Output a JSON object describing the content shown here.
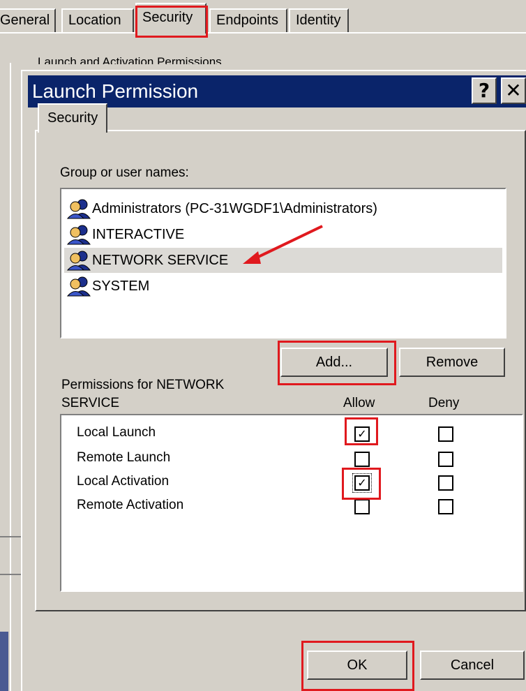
{
  "background_window": {
    "tabs": [
      "General",
      "Location",
      "Security",
      "Endpoints",
      "Identity"
    ],
    "active_tab": "Security",
    "group_caption": "Launch and Activation Permissions"
  },
  "dialog": {
    "title": "Launch Permission",
    "help_button": "?",
    "close_button": "✕",
    "tab": "Security",
    "group_label": "Group or user names:",
    "users": [
      "Administrators (PC-31WGDF1\\Administrators)",
      "INTERACTIVE",
      "NETWORK SERVICE",
      "SYSTEM"
    ],
    "selected_user": "NETWORK SERVICE",
    "add_button": "Add...",
    "remove_button": "Remove",
    "permissions_label": "Permissions for NETWORK\nSERVICE",
    "permissions_label_line1": "Permissions for NETWORK",
    "permissions_label_line2": "SERVICE",
    "allow_header": "Allow",
    "deny_header": "Deny",
    "permissions": [
      {
        "name": "Local Launch",
        "allow": true,
        "deny": false
      },
      {
        "name": "Remote Launch",
        "allow": false,
        "deny": false
      },
      {
        "name": "Local Activation",
        "allow": true,
        "deny": false
      },
      {
        "name": "Remote Activation",
        "allow": false,
        "deny": false
      }
    ],
    "ok_button": "OK",
    "cancel_button": "Cancel"
  },
  "annotation_color": "#e0191e",
  "title_bar_color": "#0a246a",
  "check_mark": "✓"
}
